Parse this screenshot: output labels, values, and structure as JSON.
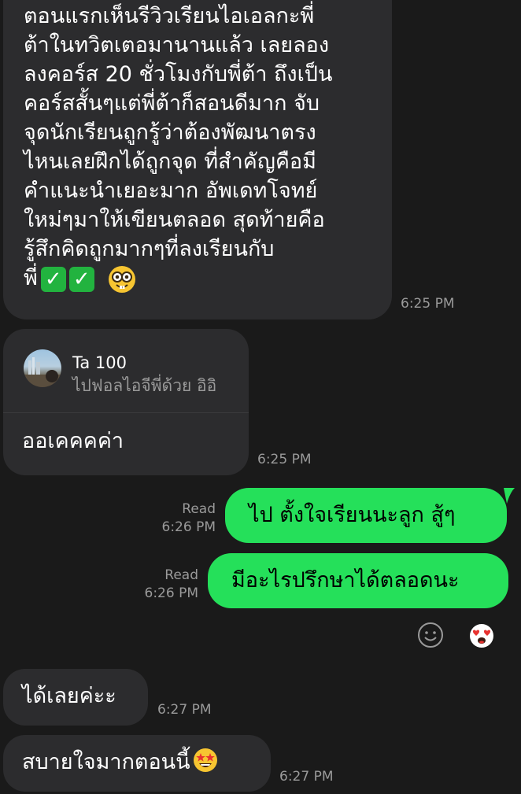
{
  "messages": {
    "m1": {
      "lines": [
        "ตอนแรกเห็นรีวิวเรียนไอเอลกะพี่",
        "ต้าในทวิตเตอมานานแล้ว เลยลอง",
        "ลงคอร์ส 20 ชั่วโมงกับพี่ต้า ถึงเป็น",
        "คอร์สสั้นๆแต่พี่ต้าก็สอนดีมาก จับ",
        "จุดนักเรียนถูกรู้ว่าต้องพัฒนาตรง",
        "ไหนเลยฝึกได้ถูกจุด ที่สำคัญคือมี",
        "คำแนะนำเยอะมาก อัพเดทโจทย์",
        "ใหม่ๆมาให้เขียนตลอด สุดท้ายคือ",
        "รู้สึกคิดถูกมากๆที่ลงเรียนกับ"
      ],
      "last_line_prefix": "พี่",
      "time": "6:25 PM"
    },
    "m2": {
      "quote_name": "Ta 100",
      "quote_text": "ไปฟอลไอจีพี่ด้วย อิอิ",
      "text": "ออเคคคค่า",
      "time": "6:25 PM"
    },
    "m3": {
      "text": "ไป ตั้งใจเรียนนะลูก สู้ๆ",
      "status": "Read",
      "time": "6:26 PM"
    },
    "m4": {
      "text": "มีอะไรปรึกษาได้ตลอดนะ",
      "status": "Read",
      "time": "6:26 PM"
    },
    "m5": {
      "text": "ได้เลยค่ะะ",
      "time": "6:27 PM"
    },
    "m6": {
      "text": "สบายใจมากตอนนี้",
      "time": "6:27 PM"
    }
  },
  "icons": {
    "check_emoji": "check-mark-button-icon",
    "nerd_emoji": "nerd-face-icon",
    "star_struck_emoji": "star-struck-icon",
    "add_reaction": "smiley-outline-icon",
    "reaction": "heart-eyes-icon"
  },
  "colors": {
    "background": "#1a1a1a",
    "incoming_bubble": "#2c2c2e",
    "outgoing_bubble": "#25e05a",
    "timestamp": "#9a9a9a"
  }
}
